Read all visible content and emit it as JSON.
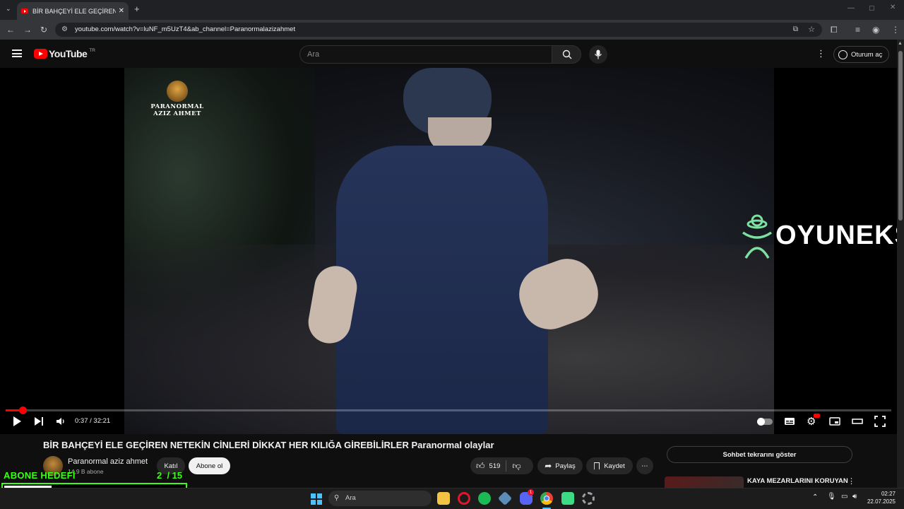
{
  "browser": {
    "tab_title": "BİR BAHÇEYİ ELE GEÇİREN NETEKİN CİNLERİ",
    "url": "youtube.com/watch?v=luNF_m5UzT4&ab_channel=Paranormalazizahmet"
  },
  "youtube": {
    "logo_text": "YouTube",
    "region": "TR",
    "search_placeholder": "Ara",
    "signin_label": "Oturum aç"
  },
  "player": {
    "time_display": "0:37 / 32:21",
    "progress_fraction": 0.0191,
    "watermark_channel_line1": "PARANORMAL",
    "watermark_channel_line2": "AZIZ AHMET",
    "watermark_brand": "OYUNEKS"
  },
  "video": {
    "title": "BİR BAHÇEYİ ELE GEÇİREN NETEKİN CİNLERİ DİKKAT HER KILIĞA GİREBİLİRLER Paranormal olaylar",
    "channel_name": "Paranormal aziz ahmet",
    "subscribers": "14,9 B abone",
    "join_label": "Katıl",
    "subscribe_label": "Abone ol",
    "like_count": "519",
    "share_label": "Paylaş",
    "save_label": "Kaydet"
  },
  "sidebar": {
    "chat_button": "Sohbet tekrarını göster",
    "recommendation_title": "KAYA MEZARLARINI KORUYAN"
  },
  "overlay": {
    "goal_label": "ABONE HEDEFİ",
    "goal_current": "2",
    "goal_target": "15",
    "goal_text": "2  / 15",
    "goal_fraction": 0.133
  },
  "taskbar": {
    "search_label": "Ara",
    "time": "02:27",
    "date": "22.07.2025",
    "discord_badge": "1"
  },
  "colors": {
    "youtube_red": "#ff0000",
    "goal_green": "#39ff14",
    "background": "#0f0f0f"
  }
}
